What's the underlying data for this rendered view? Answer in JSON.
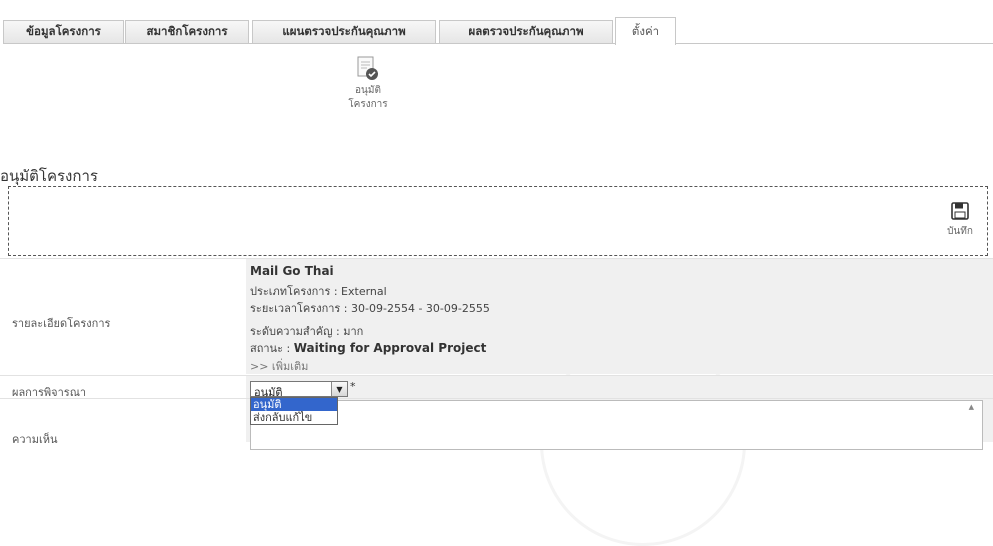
{
  "tabs": [
    {
      "label": "ข้อมูลโครงการ",
      "active": false
    },
    {
      "label": "สมาชิกโครงการ",
      "active": false
    },
    {
      "label": "แผนตรวจประกันคุณภาพ",
      "active": false
    },
    {
      "label": "ผลตรวจประกันคุณภาพ",
      "active": false
    },
    {
      "label": "ตั้งค่า",
      "active": true
    }
  ],
  "toolbar": {
    "approve_line1": "อนุมัติ",
    "approve_line2": "โครงการ",
    "approve_icon": "document-check-icon"
  },
  "section": {
    "title": "อนุมัติโครงการ",
    "save_label": "บันทึก",
    "save_icon": "floppy-disk-icon"
  },
  "form": {
    "details_label": "รายละเอียดโครงการ",
    "project_name": "Mail Go Thai",
    "project_type": "ประเภทโครงการ : External",
    "duration": "ระยะเวลาโครงการ :  30-09-2554  -  30-09-2555",
    "priority": "ระดับความสำคัญ :  มาก",
    "status_prefix": "สถานะ :",
    "status_value": "Waiting for Approval Project",
    "more_link": ">> เพิ่มเติม",
    "decision_label": "ผลการพิจารณา",
    "decision_value": "อนุมัติ",
    "required_mark": "*",
    "decision_options": [
      "อนุมัติ",
      "ส่งกลับแก้ไข"
    ],
    "comment_label": "ความเห็น",
    "comment_value": ""
  },
  "colors": {
    "dropdown_highlight": "#3366cc",
    "cell_background": "#f0f0f0"
  }
}
